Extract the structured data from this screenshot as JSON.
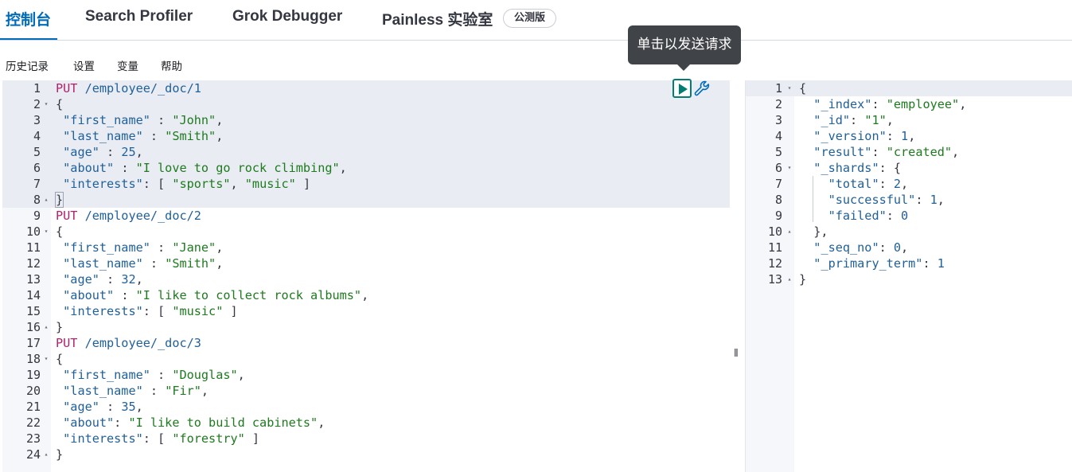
{
  "tabs": [
    {
      "label": "控制台"
    },
    {
      "label": "Search Profiler"
    },
    {
      "label": "Grok Debugger"
    },
    {
      "label": "Painless 实验室"
    }
  ],
  "beta_badge": "公测版",
  "menu": [
    "历史记录",
    "设置",
    "变量",
    "帮助"
  ],
  "tooltip": "单击以发送请求",
  "request_lines": [
    {
      "n": "1",
      "fold": "",
      "tokens": [
        [
          "m",
          "PUT"
        ],
        [
          "p",
          " "
        ],
        [
          "u",
          "/employee/_doc/1"
        ]
      ]
    },
    {
      "n": "2",
      "fold": "▾",
      "tokens": [
        [
          "p",
          "{"
        ]
      ]
    },
    {
      "n": "3",
      "fold": "",
      "tokens": [
        [
          "p",
          " "
        ],
        [
          "k",
          "\"first_name\""
        ],
        [
          "p",
          " : "
        ],
        [
          "s",
          "\"John\""
        ],
        [
          "p",
          ","
        ]
      ]
    },
    {
      "n": "4",
      "fold": "",
      "tokens": [
        [
          "p",
          " "
        ],
        [
          "k",
          "\"last_name\""
        ],
        [
          "p",
          " : "
        ],
        [
          "s",
          "\"Smith\""
        ],
        [
          "p",
          ","
        ]
      ]
    },
    {
      "n": "5",
      "fold": "",
      "tokens": [
        [
          "p",
          " "
        ],
        [
          "k",
          "\"age\""
        ],
        [
          "p",
          " : "
        ],
        [
          "n",
          "25"
        ],
        [
          "p",
          ","
        ]
      ]
    },
    {
      "n": "6",
      "fold": "",
      "tokens": [
        [
          "p",
          " "
        ],
        [
          "k",
          "\"about\""
        ],
        [
          "p",
          " : "
        ],
        [
          "s",
          "\"I love to go rock climbing\""
        ],
        [
          "p",
          ","
        ]
      ]
    },
    {
      "n": "7",
      "fold": "",
      "tokens": [
        [
          "p",
          " "
        ],
        [
          "k",
          "\"interests\""
        ],
        [
          "p",
          ": [ "
        ],
        [
          "s",
          "\"sports\""
        ],
        [
          "p",
          ", "
        ],
        [
          "s",
          "\"music\""
        ],
        [
          "p",
          " ]"
        ]
      ]
    },
    {
      "n": "8",
      "fold": "▴",
      "tokens": [
        [
          "p",
          "}"
        ]
      ]
    },
    {
      "n": "9",
      "fold": "",
      "tokens": [
        [
          "m",
          "PUT"
        ],
        [
          "p",
          " "
        ],
        [
          "u",
          "/employee/_doc/2"
        ]
      ]
    },
    {
      "n": "10",
      "fold": "▾",
      "tokens": [
        [
          "p",
          "{"
        ]
      ]
    },
    {
      "n": "11",
      "fold": "",
      "tokens": [
        [
          "p",
          " "
        ],
        [
          "k",
          "\"first_name\""
        ],
        [
          "p",
          " : "
        ],
        [
          "s",
          "\"Jane\""
        ],
        [
          "p",
          ","
        ]
      ]
    },
    {
      "n": "12",
      "fold": "",
      "tokens": [
        [
          "p",
          " "
        ],
        [
          "k",
          "\"last_name\""
        ],
        [
          "p",
          " : "
        ],
        [
          "s",
          "\"Smith\""
        ],
        [
          "p",
          ","
        ]
      ]
    },
    {
      "n": "13",
      "fold": "",
      "tokens": [
        [
          "p",
          " "
        ],
        [
          "k",
          "\"age\""
        ],
        [
          "p",
          " : "
        ],
        [
          "n",
          "32"
        ],
        [
          "p",
          ","
        ]
      ]
    },
    {
      "n": "14",
      "fold": "",
      "tokens": [
        [
          "p",
          " "
        ],
        [
          "k",
          "\"about\""
        ],
        [
          "p",
          " : "
        ],
        [
          "s",
          "\"I like to collect rock albums\""
        ],
        [
          "p",
          ","
        ]
      ]
    },
    {
      "n": "15",
      "fold": "",
      "tokens": [
        [
          "p",
          " "
        ],
        [
          "k",
          "\"interests\""
        ],
        [
          "p",
          ": [ "
        ],
        [
          "s",
          "\"music\""
        ],
        [
          "p",
          " ]"
        ]
      ]
    },
    {
      "n": "16",
      "fold": "▴",
      "tokens": [
        [
          "p",
          "}"
        ]
      ]
    },
    {
      "n": "17",
      "fold": "",
      "tokens": [
        [
          "m",
          "PUT"
        ],
        [
          "p",
          " "
        ],
        [
          "u",
          "/employee/_doc/3"
        ]
      ]
    },
    {
      "n": "18",
      "fold": "▾",
      "tokens": [
        [
          "p",
          "{"
        ]
      ]
    },
    {
      "n": "19",
      "fold": "",
      "tokens": [
        [
          "p",
          " "
        ],
        [
          "k",
          "\"first_name\""
        ],
        [
          "p",
          " : "
        ],
        [
          "s",
          "\"Douglas\""
        ],
        [
          "p",
          ","
        ]
      ]
    },
    {
      "n": "20",
      "fold": "",
      "tokens": [
        [
          "p",
          " "
        ],
        [
          "k",
          "\"last_name\""
        ],
        [
          "p",
          " : "
        ],
        [
          "s",
          "\"Fir\""
        ],
        [
          "p",
          ","
        ]
      ]
    },
    {
      "n": "21",
      "fold": "",
      "tokens": [
        [
          "p",
          " "
        ],
        [
          "k",
          "\"age\""
        ],
        [
          "p",
          " : "
        ],
        [
          "n",
          "35"
        ],
        [
          "p",
          ","
        ]
      ]
    },
    {
      "n": "22",
      "fold": "",
      "tokens": [
        [
          "p",
          " "
        ],
        [
          "k",
          "\"about\""
        ],
        [
          "p",
          ": "
        ],
        [
          "s",
          "\"I like to build cabinets\""
        ],
        [
          "p",
          ","
        ]
      ]
    },
    {
      "n": "23",
      "fold": "",
      "tokens": [
        [
          "p",
          " "
        ],
        [
          "k",
          "\"interests\""
        ],
        [
          "p",
          ": [ "
        ],
        [
          "s",
          "\"forestry\""
        ],
        [
          "p",
          " ]"
        ]
      ]
    },
    {
      "n": "24",
      "fold": "▴",
      "tokens": [
        [
          "p",
          "}"
        ]
      ]
    }
  ],
  "response_lines": [
    {
      "n": "1",
      "fold": "▾",
      "tokens": [
        [
          "p",
          "{"
        ]
      ]
    },
    {
      "n": "2",
      "fold": "",
      "tokens": [
        [
          "p",
          "  "
        ],
        [
          "k",
          "\"_index\""
        ],
        [
          "p",
          ": "
        ],
        [
          "s",
          "\"employee\""
        ],
        [
          "p",
          ","
        ]
      ]
    },
    {
      "n": "3",
      "fold": "",
      "tokens": [
        [
          "p",
          "  "
        ],
        [
          "k",
          "\"_id\""
        ],
        [
          "p",
          ": "
        ],
        [
          "s",
          "\"1\""
        ],
        [
          "p",
          ","
        ]
      ]
    },
    {
      "n": "4",
      "fold": "",
      "tokens": [
        [
          "p",
          "  "
        ],
        [
          "k",
          "\"_version\""
        ],
        [
          "p",
          ": "
        ],
        [
          "n",
          "1"
        ],
        [
          "p",
          ","
        ]
      ]
    },
    {
      "n": "5",
      "fold": "",
      "tokens": [
        [
          "p",
          "  "
        ],
        [
          "k",
          "\"result\""
        ],
        [
          "p",
          ": "
        ],
        [
          "s",
          "\"created\""
        ],
        [
          "p",
          ","
        ]
      ]
    },
    {
      "n": "6",
      "fold": "▾",
      "tokens": [
        [
          "p",
          "  "
        ],
        [
          "k",
          "\"_shards\""
        ],
        [
          "p",
          ": {"
        ]
      ]
    },
    {
      "n": "7",
      "fold": "",
      "tokens": [
        [
          "p",
          "    "
        ],
        [
          "k",
          "\"total\""
        ],
        [
          "p",
          ": "
        ],
        [
          "n",
          "2"
        ],
        [
          "p",
          ","
        ]
      ]
    },
    {
      "n": "8",
      "fold": "",
      "tokens": [
        [
          "p",
          "    "
        ],
        [
          "k",
          "\"successful\""
        ],
        [
          "p",
          ": "
        ],
        [
          "n",
          "1"
        ],
        [
          "p",
          ","
        ]
      ]
    },
    {
      "n": "9",
      "fold": "",
      "tokens": [
        [
          "p",
          "    "
        ],
        [
          "k",
          "\"failed\""
        ],
        [
          "p",
          ": "
        ],
        [
          "n",
          "0"
        ]
      ]
    },
    {
      "n": "10",
      "fold": "▴",
      "tokens": [
        [
          "p",
          "  },"
        ]
      ]
    },
    {
      "n": "11",
      "fold": "",
      "tokens": [
        [
          "p",
          "  "
        ],
        [
          "k",
          "\"_seq_no\""
        ],
        [
          "p",
          ": "
        ],
        [
          "n",
          "0"
        ],
        [
          "p",
          ","
        ]
      ]
    },
    {
      "n": "12",
      "fold": "",
      "tokens": [
        [
          "p",
          "  "
        ],
        [
          "k",
          "\"_primary_term\""
        ],
        [
          "p",
          ": "
        ],
        [
          "n",
          "1"
        ]
      ]
    },
    {
      "n": "13",
      "fold": "▴",
      "tokens": [
        [
          "p",
          "}"
        ]
      ]
    }
  ],
  "splitter_glyph": "‖",
  "colors": {
    "accent": "#006bb8",
    "run": "#017d73",
    "method": "#b3206b",
    "string": "#1e7a1e",
    "key": "#1f5f9a"
  }
}
